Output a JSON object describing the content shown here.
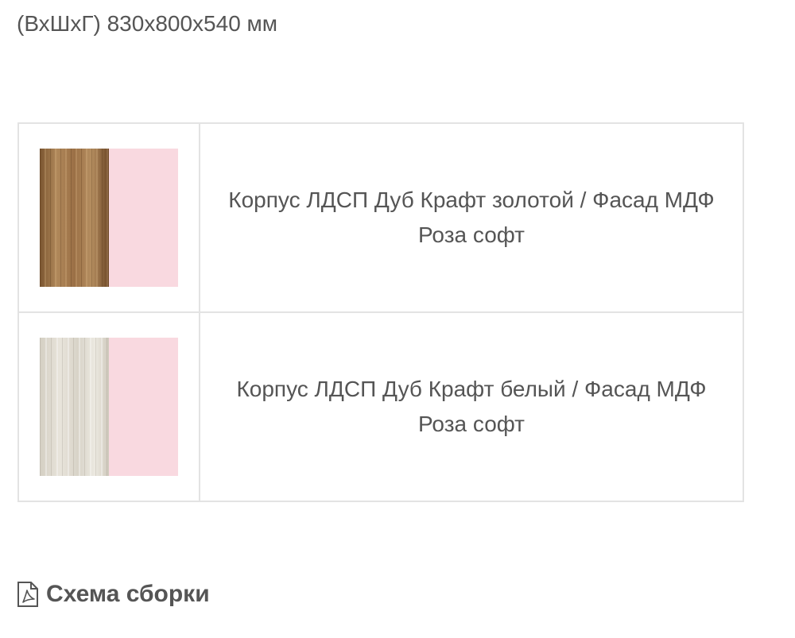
{
  "product": {
    "dimensions": "(ВхШхГ) 830х800х540 мм"
  },
  "variants": [
    {
      "wood": "wood-golden",
      "facade_color": "#f9d9e0",
      "description": "Корпус ЛДСП Дуб Крафт золотой / Фасад МДФ Роза софт"
    },
    {
      "wood": "wood-white",
      "facade_color": "#f9d9e0",
      "description": "Корпус ЛДСП Дуб Крафт белый / Фасад МДФ Роза софт"
    }
  ],
  "assembly_link": {
    "icon": "pdf-icon",
    "label": "Схема сборки"
  },
  "colors": {
    "text": "#555555",
    "border": "#e3e3e3",
    "rose_soft": "#f9d9e0"
  }
}
